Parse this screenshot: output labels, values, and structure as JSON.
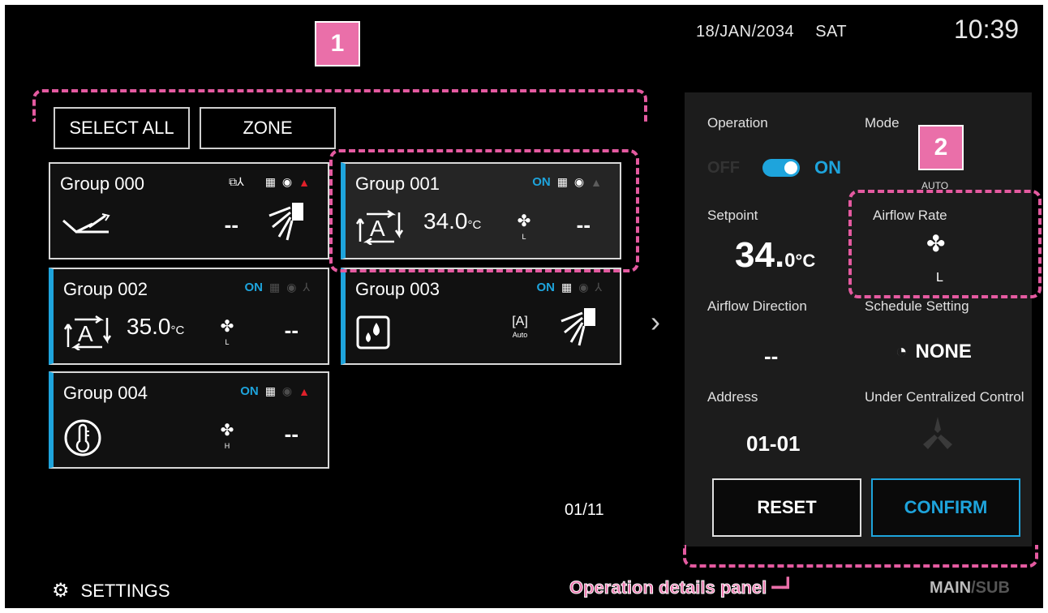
{
  "header": {
    "date": "18/JAN/2034",
    "day": "SAT",
    "time": "10:39"
  },
  "top_buttons": {
    "select_all": "SELECT ALL",
    "zone": "ZONE"
  },
  "groups": [
    {
      "name": "Group 000",
      "status": "",
      "temp": "",
      "airflow": "",
      "value": "--"
    },
    {
      "name": "Group 001",
      "status": "ON",
      "temp": "34.0",
      "unit": "°C",
      "airflow": "L",
      "value": "--"
    },
    {
      "name": "Group 002",
      "status": "ON",
      "temp": "35.0",
      "unit": "°C",
      "airflow": "L",
      "value": "--"
    },
    {
      "name": "Group 003",
      "status": "ON",
      "mode_label": "Auto",
      "value": ""
    },
    {
      "name": "Group 004",
      "status": "ON",
      "airflow": "H",
      "value": "--"
    }
  ],
  "pager": "01/11",
  "settings_label": "SETTINGS",
  "panel": {
    "operation_label": "Operation",
    "off_label": "OFF",
    "on_label": "ON",
    "mode_label": "Mode",
    "mode_value": "AUTO",
    "setpoint_label": "Setpoint",
    "setpoint_value": "34.",
    "setpoint_decimal": "0",
    "setpoint_unit": "°C",
    "airflow_rate_label": "Airflow Rate",
    "airflow_rate_value": "L",
    "airflow_direction_label": "Airflow Direction",
    "airflow_direction_value": "--",
    "schedule_label": "Schedule Setting",
    "schedule_value": "NONE",
    "address_label": "Address",
    "address_value": "01-01",
    "centralized_label": "Under Centralized Control",
    "reset_label": "RESET",
    "confirm_label": "CONFIRM"
  },
  "annotations": {
    "callout_1": "1",
    "callout_2": "2",
    "panel_caption": "Operation details panel"
  },
  "footer": {
    "main": "MAIN",
    "sep": "/",
    "sub": "SUB"
  },
  "colors": {
    "accent": "#1ea4dc",
    "annotation": "#ea6fa9",
    "warning": "#e0202a"
  }
}
